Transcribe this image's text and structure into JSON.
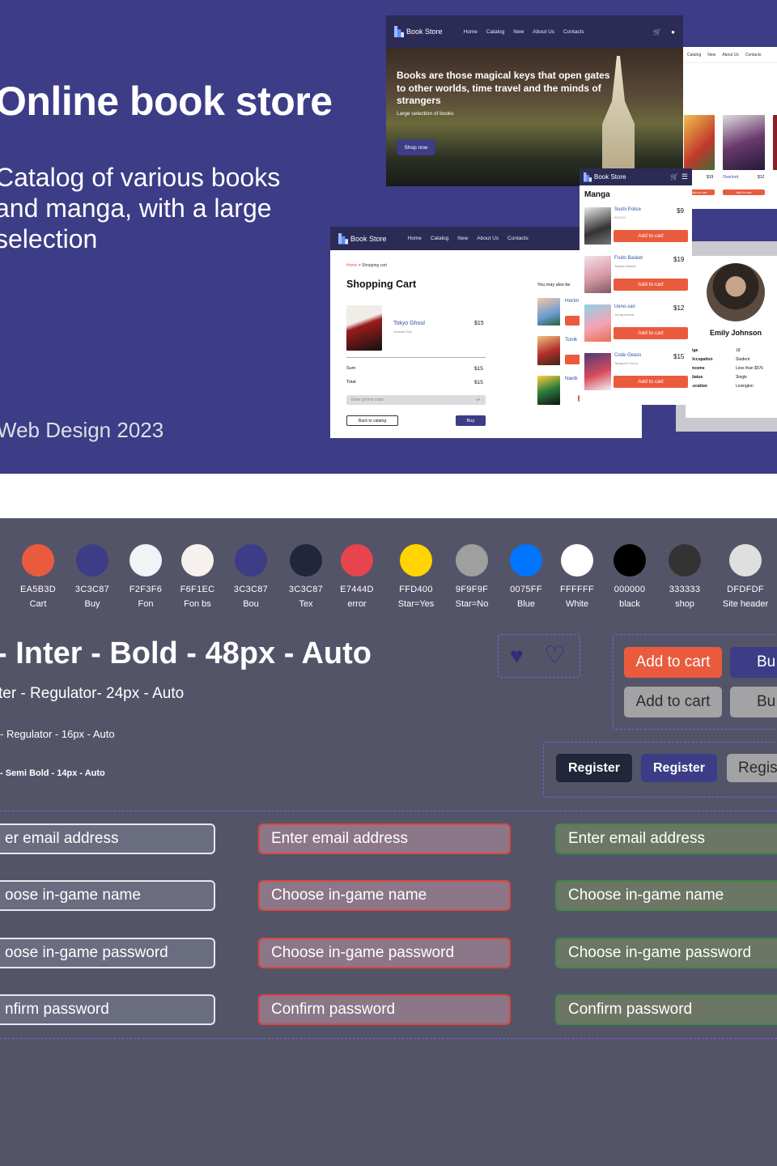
{
  "hero": {
    "title": "Online book store",
    "subtitle": "Catalog of various books and manga, with a large selection",
    "year": "Web Design 2023"
  },
  "mock_home": {
    "brand": "Book Store",
    "nav": [
      "Home",
      "Catalog",
      "New",
      "About Us",
      "Contacts"
    ],
    "headline": "Books are those magical keys that open gates to other worlds, time travel and the minds of strangers",
    "tagline": "Large selection of books",
    "cta": "Shop now"
  },
  "mock_catalog": {
    "nav": [
      "Catalog",
      "New",
      "About Us",
      "Contacts"
    ],
    "items": [
      {
        "price": "$19",
        "title": "Overlord",
        "price2": "$12"
      }
    ],
    "btn": "Add to cart"
  },
  "mock_cart": {
    "brand": "Book Store",
    "nav": [
      "Home",
      "Catalog",
      "New",
      "About Us",
      "Contacts"
    ],
    "breadcrumb_home": "Home",
    "breadcrumb_current": "Shopping cart",
    "title": "Shopping Cart",
    "item": {
      "name": "Tokyo Ghoul",
      "author": "Yowada Shin",
      "price": "$15"
    },
    "sum_label": "Sum",
    "sum_value": "$15",
    "total_label": "Total",
    "total_value": "$15",
    "promo_placeholder": "Enter promo code",
    "back_btn": "Back to catalog",
    "buy_btn": "Buy",
    "also_label": "You may also be",
    "also": [
      "Horim",
      "Tonik",
      "Nanb"
    ],
    "add": "Add to cart"
  },
  "mock_manga": {
    "brand": "Book Store",
    "heading": "Manga",
    "items": [
      {
        "title": "Sushi Police",
        "author": "KOO-KI",
        "price": "$9",
        "cover": "#e8e8ea"
      },
      {
        "title": "Fruits Basket",
        "author": "Takaya Natsuki",
        "price": "$19",
        "cover": "#f1d7df"
      },
      {
        "title": "Ueno-san",
        "author": "Young Animal",
        "price": "$12",
        "cover": "#8fd3e6"
      },
      {
        "title": "Code Geass",
        "author": "Taniguchi Gorou",
        "price": "$15",
        "cover": "#4b3d78"
      }
    ],
    "btn": "Add to cart"
  },
  "mock_profile": {
    "name": "Emily Johnson",
    "rows": [
      {
        "k": "Age",
        "v": "18"
      },
      {
        "k": "Occupation",
        "v": "Student"
      },
      {
        "k": "Income",
        "v": "Less than $57k"
      },
      {
        "k": "Status",
        "v": "Single"
      },
      {
        "k": "Location",
        "v": "Lexington"
      }
    ]
  },
  "palette": [
    {
      "hex": "EA5B3D",
      "name": "Cart",
      "color": "#EA5B3D"
    },
    {
      "hex": "3C3C87",
      "name": "Buy",
      "color": "#3C3C87"
    },
    {
      "hex": "F2F3F6",
      "name": "Fon",
      "color": "#F2F3F6"
    },
    {
      "hex": "F6F1EC",
      "name": "Fon bs",
      "color": "#F6F1EC"
    },
    {
      "hex": "3C3C87",
      "name": "Bou",
      "color": "#3C3C87"
    },
    {
      "hex": "3C3C87",
      "name": "Tex",
      "color": "#22263A"
    },
    {
      "hex": "E7444D",
      "name": "error",
      "color": "#E7444D"
    },
    {
      "hex": "FFD400",
      "name": "Star=Yes",
      "color": "#FFD400"
    },
    {
      "hex": "9F9F9F",
      "name": "Star=No",
      "color": "#9F9F9F"
    },
    {
      "hex": "0075FF",
      "name": "Blue",
      "color": "#0075FF"
    },
    {
      "hex": "FFFFFF",
      "name": "White",
      "color": "#FFFFFF"
    },
    {
      "hex": "000000",
      "name": "black",
      "color": "#000000"
    },
    {
      "hex": "333333",
      "name": "shop",
      "color": "#333333"
    },
    {
      "hex": "DFDFDF",
      "name": "Site header",
      "color": "#DFDFDF"
    }
  ],
  "typography": {
    "t1": "- Inter - Bold - 48px - Auto",
    "t2": "ter - Regulator- 24px - Auto",
    "t3": "- Regulator - 16px - Auto",
    "t4": "- Semi Bold - 14px - Auto"
  },
  "buttons": {
    "add_cart": "Add to cart",
    "buy": "Bu",
    "register": "Register",
    "register_cut": "Regis"
  },
  "fields": {
    "col1": [
      "er email address",
      "oose in-game name",
      "oose in-game password",
      "nfirm password"
    ],
    "col2": [
      "Enter email address",
      "Choose in-game name",
      "Choose in-game password",
      "Confirm password"
    ],
    "col3": [
      "Enter email address",
      "Choose in-game name",
      "Choose in-game password",
      "Confirm password"
    ]
  },
  "colors": {
    "hero_bg": "#3C3C87",
    "lower_bg": "#545469",
    "accent_red": "#EA5B3D"
  }
}
